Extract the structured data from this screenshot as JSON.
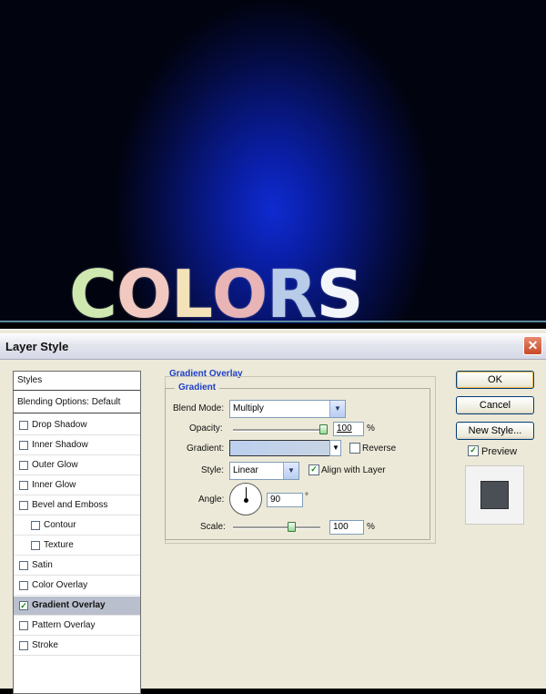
{
  "artwork": {
    "word_letters": [
      {
        "char": "C",
        "color": "#cfe8b0"
      },
      {
        "char": "O",
        "color": "#f2c9c0"
      },
      {
        "char": "L",
        "color": "#f4e2b8"
      },
      {
        "char": "O",
        "color": "#e8b4b6"
      },
      {
        "char": "R",
        "color": "#b8cbe8"
      },
      {
        "char": "S",
        "color": "#f2f6fb"
      }
    ]
  },
  "dialog": {
    "title": "Layer Style",
    "close_icon": "close-icon"
  },
  "styles_list": {
    "header": "Styles",
    "blending": "Blending Options: Default",
    "items": [
      {
        "label": "Drop Shadow",
        "checked": false
      },
      {
        "label": "Inner Shadow",
        "checked": false
      },
      {
        "label": "Outer Glow",
        "checked": false
      },
      {
        "label": "Inner Glow",
        "checked": false
      },
      {
        "label": "Bevel and Emboss",
        "checked": false
      },
      {
        "label": "Contour",
        "checked": false,
        "indent": true
      },
      {
        "label": "Texture",
        "checked": false,
        "indent": true
      },
      {
        "label": "Satin",
        "checked": false
      },
      {
        "label": "Color Overlay",
        "checked": false
      },
      {
        "label": "Gradient Overlay",
        "checked": true,
        "selected": true
      },
      {
        "label": "Pattern Overlay",
        "checked": false
      },
      {
        "label": "Stroke",
        "checked": false
      }
    ]
  },
  "gradient_overlay": {
    "section_title": "Gradient Overlay",
    "group_title": "Gradient",
    "blend_mode_label": "Blend Mode:",
    "blend_mode_value": "Multiply",
    "opacity_label": "Opacity:",
    "opacity_value": "100",
    "opacity_unit": "%",
    "opacity_slider": 1.0,
    "gradient_label": "Gradient:",
    "reverse_label": "Reverse",
    "reverse_checked": false,
    "style_label": "Style:",
    "style_value": "Linear",
    "align_label": "Align with Layer",
    "align_checked": true,
    "angle_label": "Angle:",
    "angle_value": "90",
    "angle_unit": "°",
    "scale_label": "Scale:",
    "scale_value": "100",
    "scale_unit": "%",
    "scale_slider": 0.6
  },
  "buttons": {
    "ok": "OK",
    "cancel": "Cancel",
    "new_style": "New Style...",
    "preview_label": "Preview",
    "preview_checked": true
  },
  "colors": {
    "section_title": "#1f40c8",
    "selected_row": "#b9bfcd",
    "dialog_bg": "#ece9d8"
  }
}
